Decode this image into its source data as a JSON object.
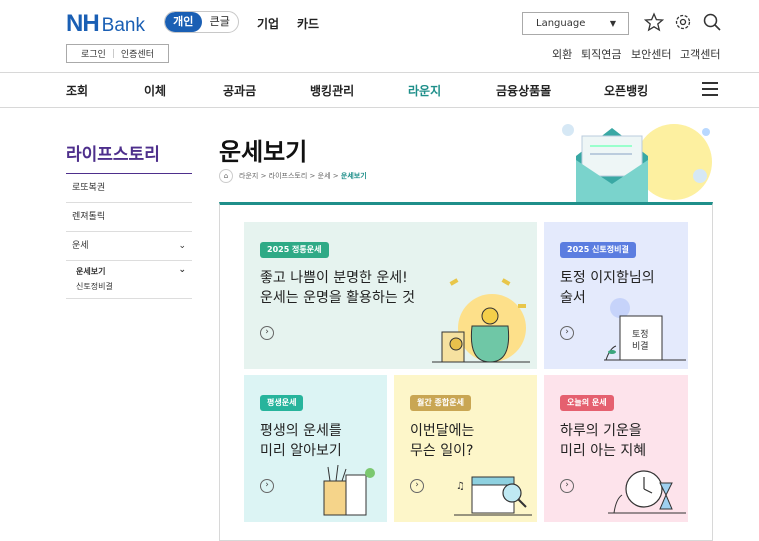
{
  "header": {
    "logo_nh": "NH",
    "logo_bank": "Bank",
    "segments": [
      "개인",
      "큰글"
    ],
    "nav": [
      "기업",
      "카드"
    ],
    "language": "Language",
    "login": "로그인",
    "cert": "인증센터",
    "util": [
      "외환",
      "퇴직연금",
      "보안센터",
      "고객센터"
    ]
  },
  "menu": [
    "조회",
    "이체",
    "공과금",
    "뱅킹관리",
    "라운지",
    "금융상품몰",
    "오픈뱅킹"
  ],
  "menu_active": "라운지",
  "sidebar": {
    "title": "라이프스토리",
    "items": [
      "로또복권",
      "렌져톨릭",
      "운세",
      "운세보기"
    ],
    "sub": "신토정비결"
  },
  "main": {
    "title": "운세보기",
    "breadcrumb": [
      "라운지",
      ">",
      "라이프스토리",
      ">",
      "운세",
      ">",
      "운세보기"
    ]
  },
  "cards": [
    {
      "badge": "2025 정통운세",
      "title": "좋고 나쁨이 분명한 운세!\n운세는 운명을 활용하는 것",
      "bg": "#e6f3ef",
      "badge_color": "#2faa86"
    },
    {
      "badge": "2025 신토정비결",
      "title": "토정 이지함님의\n술서",
      "bg": "#e4eafc",
      "badge_color": "#5b7de0",
      "book_label": "토정\n비결"
    },
    {
      "badge": "평생운세",
      "title": "평생의 운세를\n미리 알아보기",
      "bg": "#dcf4f4",
      "badge_color": "#27b49c"
    },
    {
      "badge": "월간 종합운세",
      "title": "이번달에는\n무슨 일이?",
      "bg": "#fdf6c9",
      "badge_color": "#c9a653"
    },
    {
      "badge": "오늘의 운세",
      "title": "하루의 기운을\n미리 아는 지혜",
      "bg": "#fde3eb",
      "badge_color": "#e5606f"
    }
  ],
  "colors": {
    "brand": "#1a5fb4",
    "accent": "#1f8f8a",
    "sidebar_title": "#4e2f8c"
  }
}
